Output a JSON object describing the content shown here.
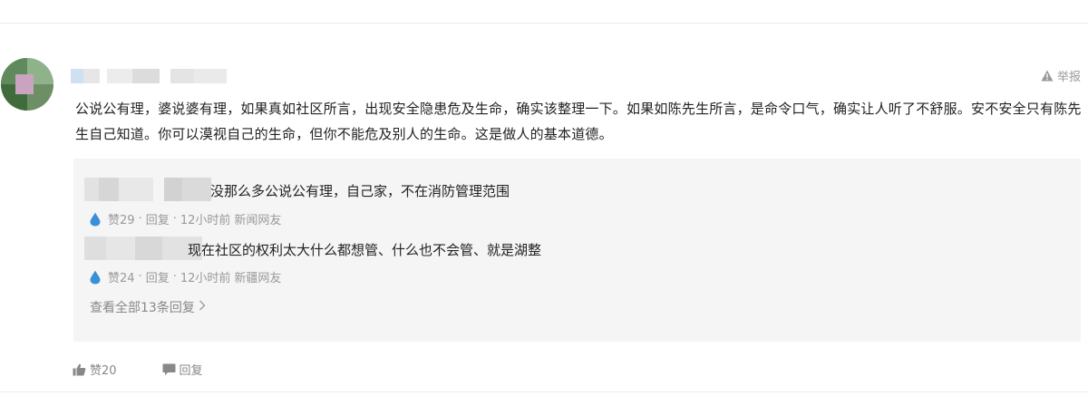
{
  "report": {
    "label": "举报",
    "icon": "warning-triangle-icon"
  },
  "comment": {
    "text": "公说公有理，婆说婆有理，如果真如社区所言，出现安全隐患危及生命，确实该整理一下。如果如陈先生所言，是命令口气，确实让人听了不舒服。安不安全只有陈先生自己知道。你可以漠视自己的生命，但你不能危及别人的生命。这是做人的基本道德。",
    "likes_label": "赞20",
    "reply_label": "回复"
  },
  "replies": [
    {
      "text": "没那么多公说公有理，自己家，不在消防管理范围",
      "likes": "赞29",
      "reply": "回复",
      "time": "12小时前",
      "source": "新闻网友"
    },
    {
      "text": "现在社区的权利太大什么都想管、什么也不会管、就是湖整",
      "likes": "赞24",
      "reply": "回复",
      "time": "12小时前",
      "source": "新疆网友"
    }
  ],
  "view_all": {
    "label": "查看全部13条回复",
    "icon": "chevron-right-icon"
  },
  "colors": {
    "text": "#222222",
    "meta": "#999999",
    "reply_bg": "#f5f5f5",
    "like_drop": "#3a8fd9"
  }
}
